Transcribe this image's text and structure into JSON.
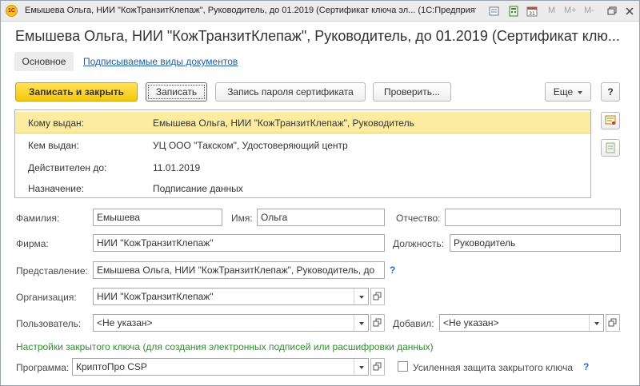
{
  "window": {
    "title": "Емышева Ольга, НИИ \"КожТранзитКлепаж\", Руководитель, до 01.2019 (Сертификат ключа эл...  (1С:Предприятие)",
    "app_logo": "1С",
    "toolbar_text": [
      "M",
      "M+",
      "M-"
    ]
  },
  "heading": "Емышева Ольга, НИИ \"КожТранзитКлепаж\", Руководитель, до 01.2019 (Сертификат клю...",
  "tabs": {
    "main": "Основное",
    "signed_docs": "Подписываемые виды документов"
  },
  "toolbar": {
    "save_close": "Записать и закрыть",
    "save": "Записать",
    "cert_password": "Запись пароля сертификата",
    "check": "Проверить...",
    "more": "Еще",
    "help": "?"
  },
  "info": [
    {
      "key": "Кому выдан:",
      "value": "Емышева Ольга, НИИ \"КожТранзитКлепаж\", Руководитель"
    },
    {
      "key": "Кем выдан:",
      "value": "УЦ ООО \"Такском\", Удостоверяющий центр"
    },
    {
      "key": "Действителен до:",
      "value": "11.01.2019"
    },
    {
      "key": "Назначение:",
      "value": "Подписание данных"
    }
  ],
  "form": {
    "surname_label": "Фамилия:",
    "surname": "Емышева",
    "name_label": "Имя:",
    "name": "Ольга",
    "patronymic_label": "Отчество:",
    "patronymic": "",
    "firm_label": "Фирма:",
    "firm": "НИИ \"КожТранзитКлепаж\"",
    "position_label": "Должность:",
    "position": "Руководитель",
    "presentation_label": "Представление:",
    "presentation": "Емышева Ольга, НИИ \"КожТранзитКлепаж\", Руководитель, до",
    "help_q": "?",
    "org_label": "Организация:",
    "org": "НИИ \"КожТранзитКлепаж\"",
    "user_label": "Пользователь:",
    "user": "<Не указан>",
    "added_label": "Добавил:",
    "added": "<Не указан>",
    "key_settings": "Настройки закрытого ключа (для создания электронных подписей или расшифровки данных)",
    "program_label": "Программа:",
    "program": "КриптоПро CSP",
    "enhanced_label": "Усиленная защита закрытого ключа",
    "enhanced_checked": false
  },
  "colors": {
    "primary_button": "#f6c70b",
    "selected_row": "#fbeca2",
    "link": "#1f5ea8",
    "section_green": "#2f8f2f"
  }
}
